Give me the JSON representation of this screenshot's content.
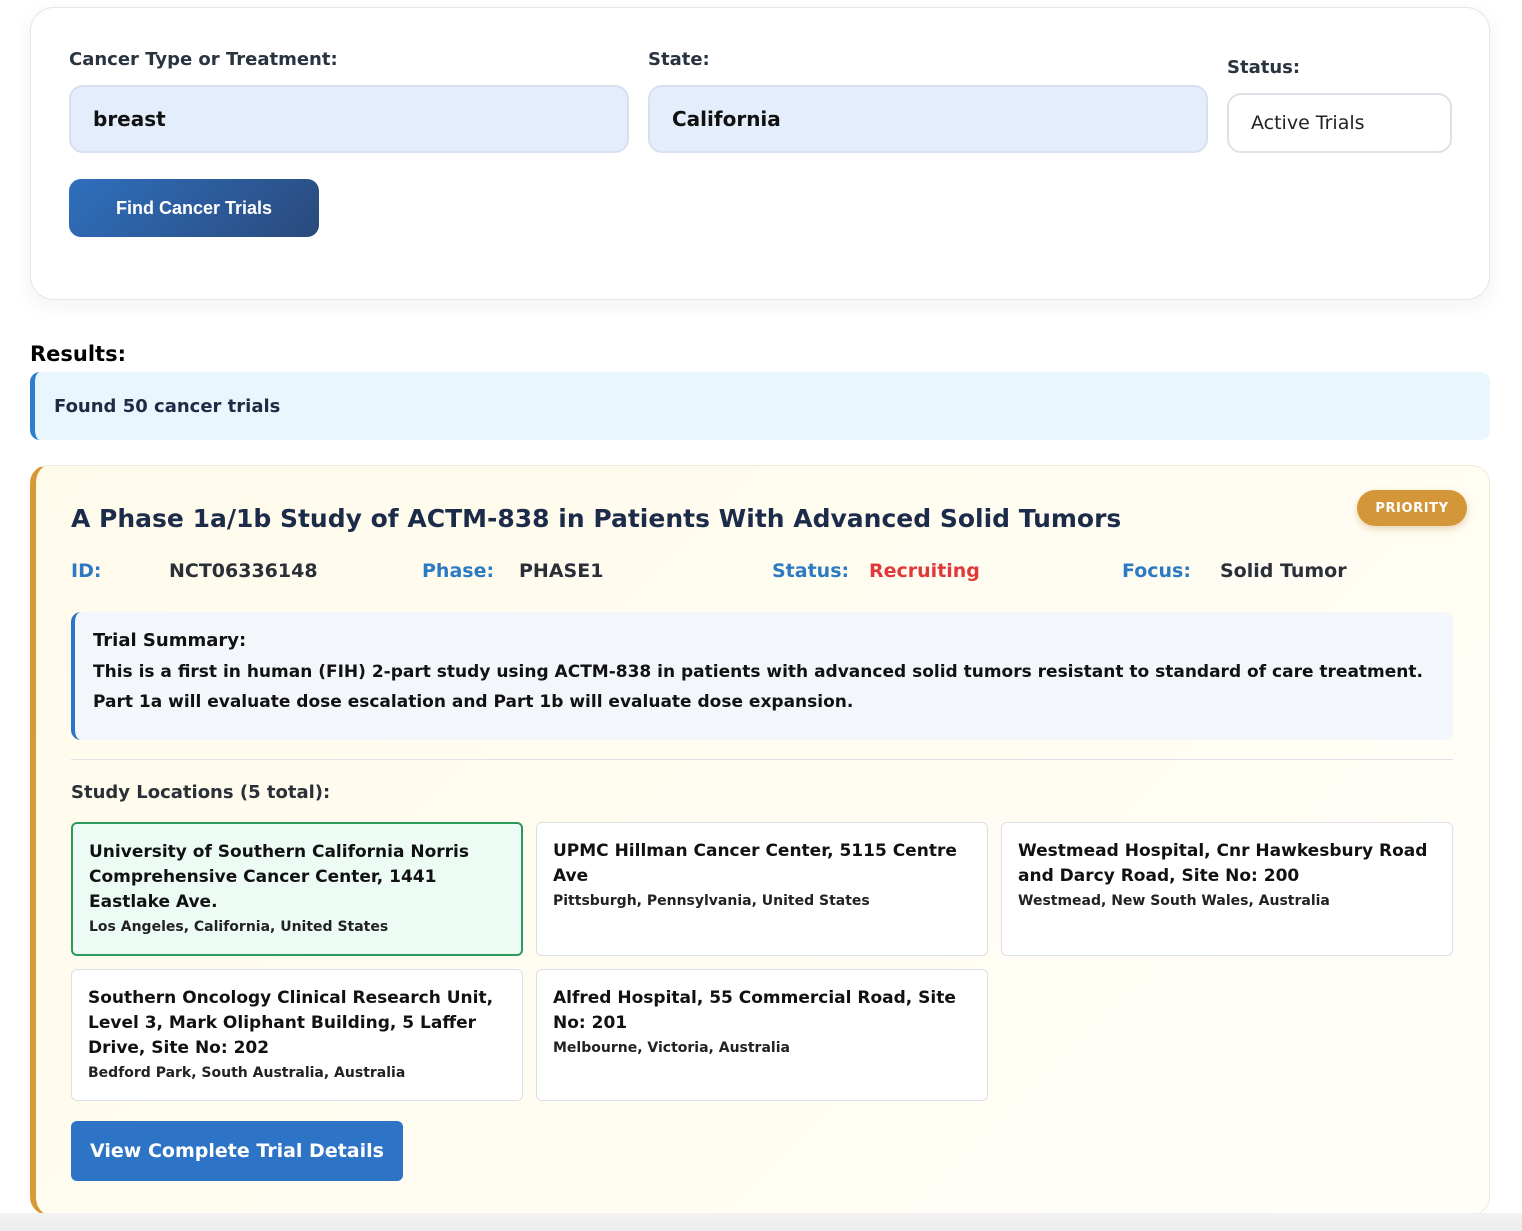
{
  "search": {
    "cancer_label": "Cancer Type or Treatment:",
    "cancer_value": "breast",
    "state_label": "State:",
    "state_value": "California",
    "status_label": "Status:",
    "status_value": "Active Trials",
    "find_button": "Find Cancer Trials"
  },
  "results": {
    "heading": "Results:",
    "found_text": "Found 50 cancer trials"
  },
  "trial": {
    "badge": "PRIORITY",
    "title": "A Phase 1a/1b Study of ACTM-838 in Patients With Advanced Solid Tumors",
    "id_label": "ID:",
    "id_value": "NCT06336148",
    "phase_label": "Phase:",
    "phase_value": "PHASE1",
    "status_label": "Status:",
    "status_value": "Recruiting",
    "focus_label": "Focus:",
    "focus_value": "Solid Tumor",
    "summary_title": "Trial Summary:",
    "summary_text": "This is a first in human (FIH) 2-part study using ACTM-838 in patients with advanced solid tumors resistant to standard of care treatment. Part 1a will evaluate dose escalation and Part 1b will evaluate dose expansion.",
    "locations_heading": "Study Locations (5 total):",
    "locations": [
      {
        "name": "University of Southern California Norris Comprehensive Cancer Center, 1441 Eastlake Ave.",
        "address": "Los Angeles, California, United States"
      },
      {
        "name": "UPMC Hillman Cancer Center, 5115 Centre Ave",
        "address": "Pittsburgh, Pennsylvania, United States"
      },
      {
        "name": "Westmead Hospital, Cnr Hawkesbury Road and Darcy Road, Site No: 200",
        "address": "Westmead, New South Wales, Australia"
      },
      {
        "name": "Southern Oncology Clinical Research Unit, Level 3, Mark Oliphant Building, 5 Laffer Drive, Site No: 202",
        "address": "Bedford Park, South Australia, Australia"
      },
      {
        "name": "Alfred Hospital, 55 Commercial Road, Site No: 201",
        "address": "Melbourne, Victoria, Australia"
      }
    ],
    "details_button": "View Complete Trial Details"
  },
  "colors": {
    "accent_blue": "#2e74c6",
    "priority_gold": "#d3973a",
    "status_red": "#e0393b",
    "highlight_green": "#2b9a5b"
  }
}
